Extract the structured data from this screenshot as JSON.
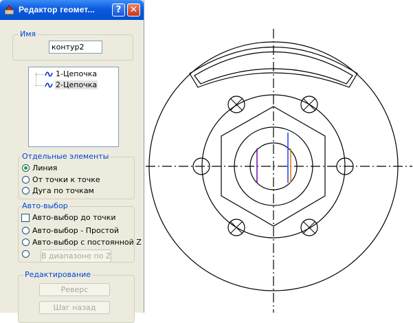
{
  "window": {
    "title": "Редактор геомет...",
    "help_label": "?",
    "close_label": "✕"
  },
  "name_group": {
    "legend": "Имя",
    "value": "контур2"
  },
  "tree": {
    "items": [
      {
        "label": "1-Цепочка",
        "icon": "chain-icon",
        "selected": false
      },
      {
        "label": "2-Цепочка",
        "icon": "chain-icon",
        "selected": true
      }
    ]
  },
  "elements_group": {
    "legend": "Отдельные элементы",
    "options": [
      {
        "label": "Линия",
        "selected": true
      },
      {
        "label": "От точки к точке",
        "selected": false
      },
      {
        "label": "Дуга по точкам",
        "selected": false
      }
    ]
  },
  "auto_group": {
    "legend": "Авто-выбор",
    "checkbox_label": "Авто-выбор до точки",
    "checkbox_checked": false,
    "options": [
      {
        "label": "Авто-выбор - Простой",
        "selected": false
      },
      {
        "label": "Авто-выбор с постоянной Z",
        "selected": false
      }
    ],
    "range_button": "В диапазоне по Z"
  },
  "edit_group": {
    "legend": "Редактирование",
    "reverse_button": "Реверс",
    "step_back_button": "Шаг назад"
  },
  "colors": {
    "title_bar": "#0a5ae0",
    "legend_text": "#0046d5",
    "panel_bg": "#ecebdd",
    "drawing_line": "#000000",
    "highlight_purple": "#6a0dad",
    "highlight_blue": "#1a3cff",
    "highlight_orange": "#d08000"
  }
}
